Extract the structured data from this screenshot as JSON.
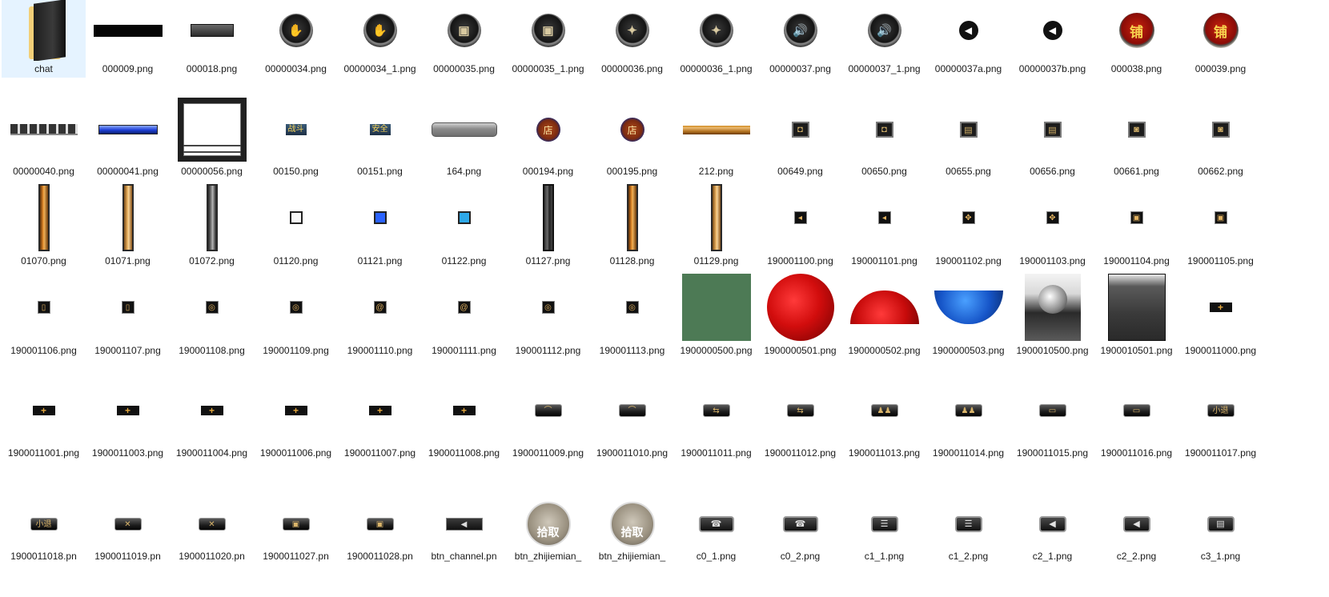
{
  "window": {
    "view": "Large icons"
  },
  "selected_index": 0,
  "items": [
    {
      "label": "chat",
      "icon": "folder-icon",
      "kind": "folder"
    },
    {
      "label": "000009.png",
      "icon": "black-bar-icon",
      "kind": "bar"
    },
    {
      "label": "000018.png",
      "icon": "stone-bar-icon",
      "kind": "bar2"
    },
    {
      "label": "00000034.png",
      "icon": "round-button-icon",
      "kind": "round",
      "glyph": "✋"
    },
    {
      "label": "00000034_1.png",
      "icon": "round-button-icon",
      "kind": "round",
      "glyph": "✋"
    },
    {
      "label": "00000035.png",
      "icon": "round-button-icon",
      "kind": "round",
      "glyph": "▣"
    },
    {
      "label": "00000035_1.png",
      "icon": "round-button-icon",
      "kind": "round",
      "glyph": "▣"
    },
    {
      "label": "00000036.png",
      "icon": "round-button-icon",
      "kind": "round",
      "glyph": "✦"
    },
    {
      "label": "00000036_1.png",
      "icon": "round-button-icon",
      "kind": "round",
      "glyph": "✦"
    },
    {
      "label": "00000037.png",
      "icon": "round-speaker-icon",
      "kind": "round",
      "glyph": "🔊"
    },
    {
      "label": "00000037_1.png",
      "icon": "round-speaker-icon",
      "kind": "round",
      "glyph": "🔊"
    },
    {
      "label": "00000037a.png",
      "icon": "speaker-icon",
      "kind": "speaker",
      "glyph": "◀"
    },
    {
      "label": "00000037b.png",
      "icon": "speaker-icon",
      "kind": "speaker",
      "glyph": "◀"
    },
    {
      "label": "000038.png",
      "icon": "shop-seal-icon",
      "kind": "red",
      "glyph": "铺"
    },
    {
      "label": "000039.png",
      "icon": "shop-seal-icon",
      "kind": "red",
      "glyph": "铺"
    },
    {
      "label": "00000040.png",
      "icon": "tab-strip-icon",
      "kind": "tabbar"
    },
    {
      "label": "00000041.png",
      "icon": "blue-bar-icon",
      "kind": "bluebar"
    },
    {
      "label": "00000056.png",
      "icon": "window-frame-icon",
      "kind": "frame"
    },
    {
      "label": "00150.png",
      "icon": "battle-label-icon",
      "kind": "label",
      "glyph": "战斗"
    },
    {
      "label": "00151.png",
      "icon": "safe-label-icon",
      "kind": "label",
      "glyph": "安全"
    },
    {
      "label": "164.png",
      "icon": "grey-bar-icon",
      "kind": "grey"
    },
    {
      "label": "000194.png",
      "icon": "store-badge-icon",
      "kind": "store",
      "glyph": "店"
    },
    {
      "label": "000195.png",
      "icon": "store-badge-icon",
      "kind": "store",
      "glyph": "店"
    },
    {
      "label": "212.png",
      "icon": "gold-bar-icon",
      "kind": "gold"
    },
    {
      "label": "00649.png",
      "icon": "small-button-icon",
      "kind": "small",
      "glyph": "◘"
    },
    {
      "label": "00650.png",
      "icon": "small-button-icon",
      "kind": "small",
      "glyph": "◘"
    },
    {
      "label": "00655.png",
      "icon": "small-button-icon",
      "kind": "small",
      "glyph": "▤"
    },
    {
      "label": "00656.png",
      "icon": "small-button-icon",
      "kind": "small",
      "glyph": "▤"
    },
    {
      "label": "00661.png",
      "icon": "small-button-icon",
      "kind": "small",
      "glyph": "◙"
    },
    {
      "label": "00662.png",
      "icon": "small-button-icon",
      "kind": "small",
      "glyph": "◙"
    },
    {
      "label": "01070.png",
      "icon": "vertical-bar-icon",
      "kind": "vbar"
    },
    {
      "label": "01071.png",
      "icon": "vertical-bar-icon",
      "kind": "vbar-gold"
    },
    {
      "label": "01072.png",
      "icon": "vertical-bar-icon",
      "kind": "vbar-dark"
    },
    {
      "label": "01120.png",
      "icon": "checkbox-icon",
      "kind": "tiny"
    },
    {
      "label": "01121.png",
      "icon": "checkbox-icon",
      "kind": "tiny-blue"
    },
    {
      "label": "01122.png",
      "icon": "checkbox-icon",
      "kind": "tiny-cyan"
    },
    {
      "label": "01127.png",
      "icon": "vertical-bar-icon",
      "kind": "vbar-slot"
    },
    {
      "label": "01128.png",
      "icon": "vertical-bar-icon",
      "kind": "vbar"
    },
    {
      "label": "01129.png",
      "icon": "vertical-bar-icon",
      "kind": "vbar-gold"
    },
    {
      "label": "190001100.png",
      "icon": "mini-button-icon",
      "kind": "mini",
      "glyph": "◂"
    },
    {
      "label": "190001101.png",
      "icon": "mini-button-icon",
      "kind": "mini",
      "glyph": "◂"
    },
    {
      "label": "190001102.png",
      "icon": "mini-button-icon",
      "kind": "mini",
      "glyph": "✥"
    },
    {
      "label": "190001103.png",
      "icon": "mini-button-icon",
      "kind": "mini",
      "glyph": "✥"
    },
    {
      "label": "190001104.png",
      "icon": "mini-button-icon",
      "kind": "mini",
      "glyph": "▣"
    },
    {
      "label": "190001105.png",
      "icon": "mini-button-icon",
      "kind": "mini",
      "glyph": "▣"
    },
    {
      "label": "190001106.png",
      "icon": "mini-button-icon",
      "kind": "mini",
      "glyph": "▯"
    },
    {
      "label": "190001107.png",
      "icon": "mini-button-icon",
      "kind": "mini",
      "glyph": "▯"
    },
    {
      "label": "190001108.png",
      "icon": "mini-button-icon",
      "kind": "mini",
      "glyph": "◎"
    },
    {
      "label": "190001109.png",
      "icon": "mini-button-icon",
      "kind": "mini",
      "glyph": "◎"
    },
    {
      "label": "190001110.png",
      "icon": "mini-button-icon",
      "kind": "mini",
      "glyph": "@"
    },
    {
      "label": "190001111.png",
      "icon": "mini-button-icon",
      "kind": "mini",
      "glyph": "@"
    },
    {
      "label": "190001112.png",
      "icon": "mini-button-icon",
      "kind": "mini",
      "glyph": "◎"
    },
    {
      "label": "190001113.png",
      "icon": "mini-button-icon",
      "kind": "mini",
      "glyph": "◎"
    },
    {
      "label": "1900000500.png",
      "icon": "green-square-icon",
      "kind": "green"
    },
    {
      "label": "1900000501.png",
      "icon": "red-sphere-icon",
      "kind": "sphere-red"
    },
    {
      "label": "1900000502.png",
      "icon": "red-half-sphere-icon",
      "kind": "half-red"
    },
    {
      "label": "1900000503.png",
      "icon": "blue-half-sphere-icon",
      "kind": "half-blue"
    },
    {
      "label": "1900010500.png",
      "icon": "orb-panel-icon",
      "kind": "orb"
    },
    {
      "label": "1900010501.png",
      "icon": "stone-panel-icon",
      "kind": "panel"
    },
    {
      "label": "1900011000.png",
      "icon": "plus-button-icon",
      "kind": "plus",
      "glyph": "+"
    },
    {
      "label": "1900011001.png",
      "icon": "plus-button-icon",
      "kind": "plus",
      "glyph": "+"
    },
    {
      "label": "1900011003.png",
      "icon": "plus-button-icon",
      "kind": "plus",
      "glyph": "+"
    },
    {
      "label": "1900011004.png",
      "icon": "plus-button-icon",
      "kind": "plus",
      "glyph": "+"
    },
    {
      "label": "1900011006.png",
      "icon": "plus-button-icon",
      "kind": "plus",
      "glyph": "+"
    },
    {
      "label": "1900011007.png",
      "icon": "plus-button-icon",
      "kind": "plus",
      "glyph": "+"
    },
    {
      "label": "1900011008.png",
      "icon": "plus-button-icon",
      "kind": "plus",
      "glyph": "+"
    },
    {
      "label": "1900011009.png",
      "icon": "game-button-icon",
      "kind": "btn",
      "glyph": "⌒"
    },
    {
      "label": "1900011010.png",
      "icon": "game-button-icon",
      "kind": "btn",
      "glyph": "⌒"
    },
    {
      "label": "1900011011.png",
      "icon": "game-button-icon",
      "kind": "btn",
      "glyph": "⇆"
    },
    {
      "label": "1900011012.png",
      "icon": "game-button-icon",
      "kind": "btn",
      "glyph": "⇆"
    },
    {
      "label": "1900011013.png",
      "icon": "game-button-icon",
      "kind": "btn",
      "glyph": "♟♟"
    },
    {
      "label": "1900011014.png",
      "icon": "game-button-icon",
      "kind": "btn",
      "glyph": "♟♟"
    },
    {
      "label": "1900011015.png",
      "icon": "game-button-icon",
      "kind": "btn",
      "glyph": "▭"
    },
    {
      "label": "1900011016.png",
      "icon": "game-button-icon",
      "kind": "btn",
      "glyph": "▭"
    },
    {
      "label": "1900011017.png",
      "icon": "game-button-icon",
      "kind": "btn",
      "glyph": "小退"
    },
    {
      "label": "1900011018.pn",
      "icon": "game-button-icon",
      "kind": "btn",
      "glyph": "小退"
    },
    {
      "label": "1900011019.pn",
      "icon": "game-button-icon",
      "kind": "btn",
      "glyph": "✕"
    },
    {
      "label": "1900011020.pn",
      "icon": "game-button-icon",
      "kind": "btn",
      "glyph": "✕"
    },
    {
      "label": "1900011027.pn",
      "icon": "game-button-icon",
      "kind": "btn",
      "glyph": "▣"
    },
    {
      "label": "1900011028.pn",
      "icon": "game-button-icon",
      "kind": "btn",
      "glyph": "▣"
    },
    {
      "label": "btn_channel.pn",
      "icon": "channel-button-icon",
      "kind": "channel",
      "glyph": "◀"
    },
    {
      "label": "btn_zhijiemian_",
      "icon": "pickup-button-icon",
      "kind": "pick",
      "glyph": "拾取"
    },
    {
      "label": "btn_zhijiemian_",
      "icon": "pickup-button-icon",
      "kind": "pick",
      "glyph": "拾取"
    },
    {
      "label": "c0_1.png",
      "icon": "phone-button-icon",
      "kind": "cbtn-lg",
      "glyph": "☎"
    },
    {
      "label": "c0_2.png",
      "icon": "phone-button-icon",
      "kind": "cbtn-lg",
      "glyph": "☎"
    },
    {
      "label": "c1_1.png",
      "icon": "list-button-icon",
      "kind": "cbtn",
      "glyph": "☰"
    },
    {
      "label": "c1_2.png",
      "icon": "list-button-icon",
      "kind": "cbtn",
      "glyph": "☰"
    },
    {
      "label": "c2_1.png",
      "icon": "speaker-button-icon",
      "kind": "cbtn",
      "glyph": "◀"
    },
    {
      "label": "c2_2.png",
      "icon": "speaker-button-icon",
      "kind": "cbtn",
      "glyph": "◀"
    },
    {
      "label": "c3_1.png",
      "icon": "chat-button-icon",
      "kind": "cbtn",
      "glyph": "▤"
    }
  ]
}
